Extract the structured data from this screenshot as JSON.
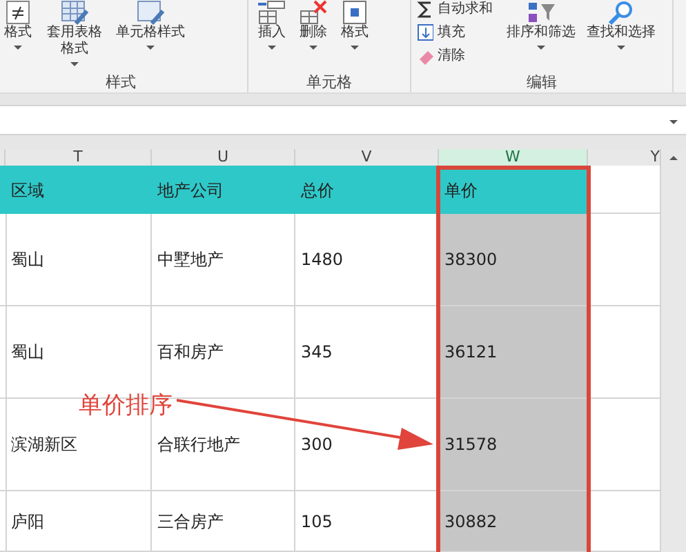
{
  "ribbon": {
    "groups": [
      {
        "label": "样式",
        "buttons": [
          {
            "label": "格式"
          },
          {
            "label": "套用表格格式"
          },
          {
            "label": "单元格样式"
          }
        ]
      },
      {
        "label": "单元格",
        "buttons": [
          {
            "label": "插入"
          },
          {
            "label": "删除"
          },
          {
            "label": "格式"
          }
        ]
      },
      {
        "label": "编辑",
        "small_buttons": [
          {
            "label": "自动求和"
          },
          {
            "label": "填充"
          },
          {
            "label": "清除"
          }
        ],
        "buttons": [
          {
            "label": "排序和筛选"
          },
          {
            "label": "查找和选择"
          }
        ]
      }
    ]
  },
  "sheet": {
    "columns": [
      {
        "label": "T",
        "selected": false
      },
      {
        "label": "U",
        "selected": false
      },
      {
        "label": "V",
        "selected": false
      },
      {
        "label": "W",
        "selected": true
      },
      {
        "label": "Y",
        "selected": false
      }
    ],
    "header": [
      "区域",
      "地产公司",
      "总价",
      "单价"
    ],
    "rows": [
      [
        "蜀山",
        "中墅地产",
        "1480",
        "38300"
      ],
      [
        "蜀山",
        "百和房产",
        "345",
        "36121"
      ],
      [
        "滨湖新区",
        "合联行地产",
        "300",
        "31578"
      ],
      [
        "庐阳",
        "三合房产",
        "105",
        "30882"
      ]
    ]
  },
  "annotation": {
    "text": "单价排序"
  }
}
